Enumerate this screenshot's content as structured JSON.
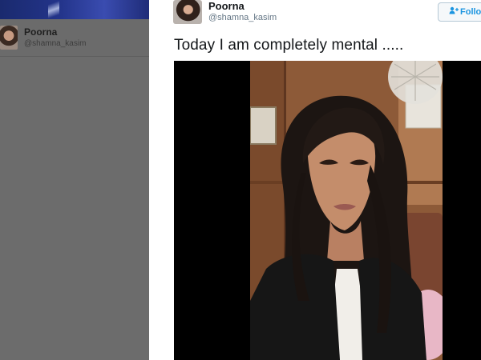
{
  "background_profile": {
    "name": "Poorna",
    "handle": "@shamna_kasim"
  },
  "tweet": {
    "author_name": "Poorna",
    "author_handle": "@shamna_kasim",
    "follow_label": "Follow",
    "text": "Today I am completely mental .....",
    "follow_icon": "add-user-icon",
    "accent_color": "#1b95e0"
  },
  "media": {
    "type": "video-still",
    "description_icon": "video-frame"
  }
}
